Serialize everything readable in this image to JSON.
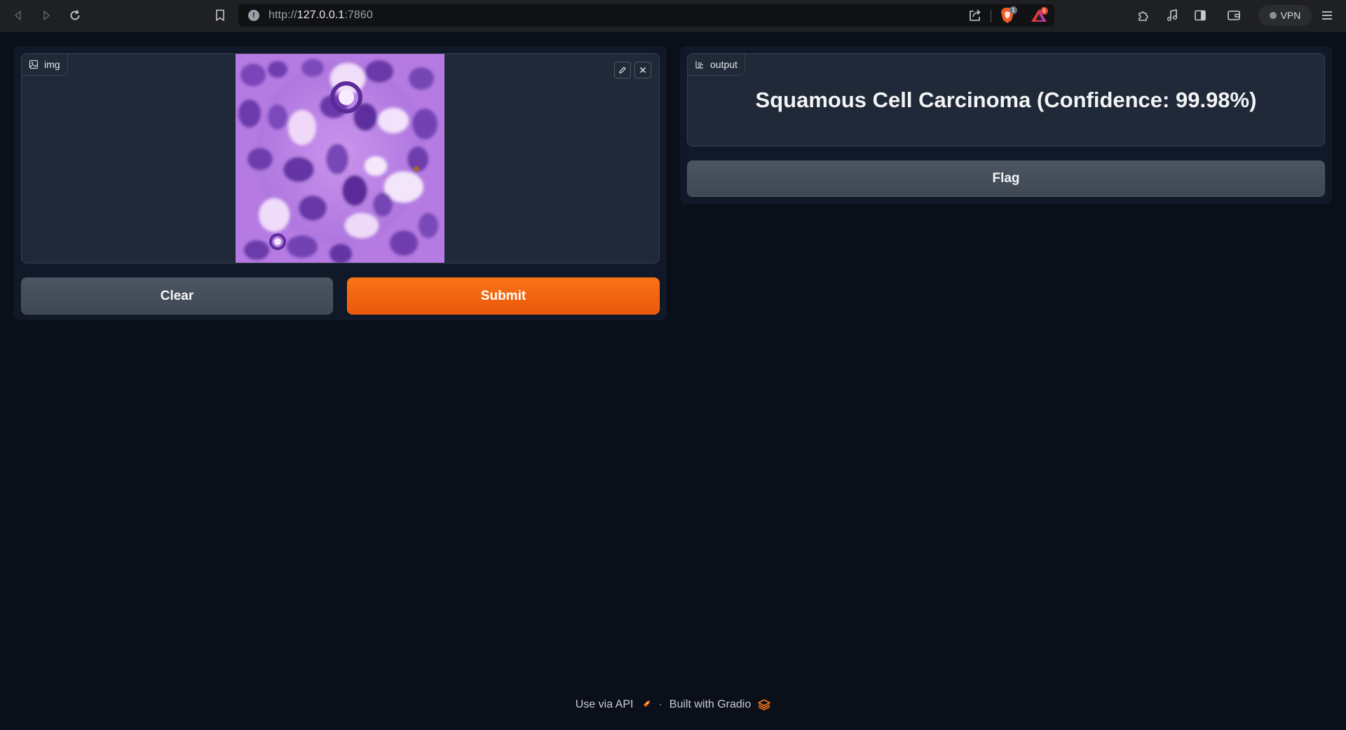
{
  "browser": {
    "url_scheme": "http://",
    "url_host": "127.0.0.1",
    "url_port": ":7860",
    "shield_badge": "1",
    "rewards_badge": "6",
    "vpn_label": "VPN"
  },
  "input": {
    "label": "img",
    "clear_label": "Clear",
    "submit_label": "Submit"
  },
  "output": {
    "label": "output",
    "text": "Squamous Cell Carcinoma (Confidence: 99.98%)",
    "flag_label": "Flag"
  },
  "footer": {
    "api_label": "Use via API",
    "separator": "·",
    "built_label": "Built with Gradio"
  },
  "colors": {
    "background": "#0b0f19",
    "panel": "#111827",
    "block": "#1f2937",
    "primary": "#f97316",
    "secondary": "#4b5563"
  }
}
